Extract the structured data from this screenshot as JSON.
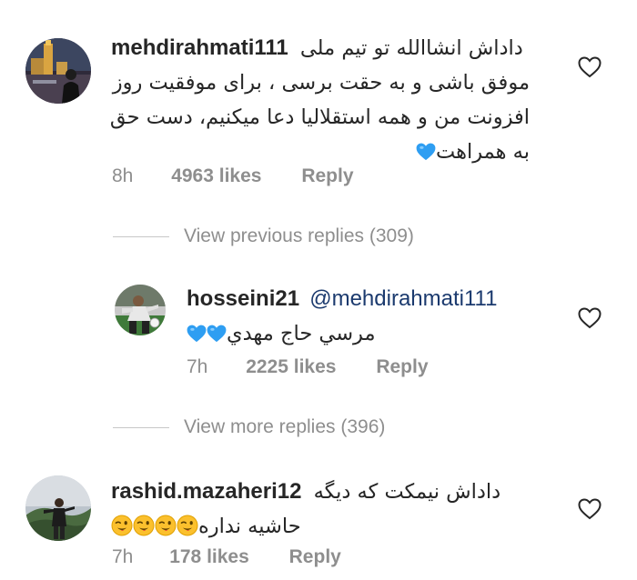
{
  "comments": [
    {
      "username": "mehdirahmati111",
      "lines": [
        "داداش انشاالله تو تیم ملی",
        "موفق باشی و به حقت برسی ، برای موفقیت روز",
        "افزونت من و همه استقلالیا دعا میکنیم، دست حق",
        "به همراهت"
      ],
      "time": "8h",
      "likes": "4963 likes",
      "reply": "Reply"
    },
    {
      "username": "hosseini21",
      "mention": "@mehdirahmati111",
      "lines": [
        "مرسي حاج مهدي"
      ],
      "time": "7h",
      "likes": "2225 likes",
      "reply": "Reply"
    },
    {
      "username": "rashid.mazaheri12",
      "lines": [
        "داداش نیمکت که دیگه",
        "حاشیه نداره"
      ],
      "time": "7h",
      "likes": "178 likes",
      "reply": "Reply"
    }
  ],
  "view_previous": "View previous replies (309)",
  "view_more": "View more replies (396)",
  "icons": {
    "like": "heart-outline-icon",
    "blue_heart": "blue-heart-emoji",
    "wink": "winking-face-emoji"
  },
  "colors": {
    "text": "#262626",
    "muted": "#8e8e8e",
    "mention": "#1b3a6e",
    "blue_heart": "#2e9ef2",
    "emoji_yellow": "#fbc02d"
  }
}
